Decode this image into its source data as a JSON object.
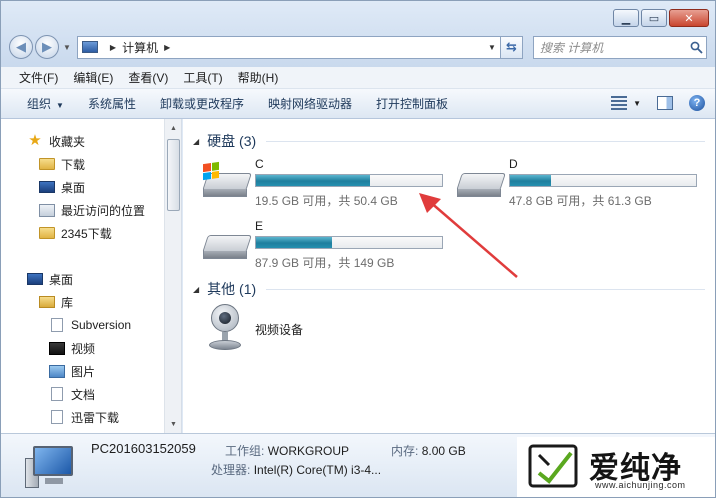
{
  "address": {
    "segments": [
      "计算机"
    ]
  },
  "search": {
    "placeholder": "搜索 计算机"
  },
  "menu": [
    "文件(F)",
    "编辑(E)",
    "查看(V)",
    "工具(T)",
    "帮助(H)"
  ],
  "toolbar": {
    "organize": "组织",
    "items": [
      "系统属性",
      "卸载或更改程序",
      "映射网络驱动器",
      "打开控制面板"
    ]
  },
  "sidebar": {
    "favorites": {
      "label": "收藏夹",
      "items": [
        "下载",
        "桌面",
        "最近访问的位置",
        "2345下载"
      ]
    },
    "desktop": {
      "label": "桌面"
    },
    "library": {
      "label": "库",
      "items": [
        "Subversion",
        "视频",
        "图片",
        "文档",
        "迅雷下载"
      ]
    }
  },
  "groups": {
    "hard_disks": "硬盘 (3)",
    "other": "其他 (1)"
  },
  "drives": [
    {
      "name": "C",
      "info": "19.5 GB 可用，共 50.4 GB",
      "used_fraction": 0.613
    },
    {
      "name": "D",
      "info": "47.8 GB 可用，共 61.3 GB",
      "used_fraction": 0.22
    },
    {
      "name": "E",
      "info": "87.9 GB 可用，共 149 GB",
      "used_fraction": 0.41
    }
  ],
  "other_devices": [
    {
      "name": "视频设备"
    }
  ],
  "details": {
    "pc_name": "PC201603152059",
    "workgroup_label": "工作组:",
    "workgroup": "WORKGROUP",
    "memory_label": "内存:",
    "memory": "8.00 GB",
    "processor_label": "处理器:",
    "processor": "Intel(R) Core(TM) i3-4..."
  },
  "watermark": {
    "brand": "爱纯净",
    "url": "www.aichunjing.com"
  },
  "colors": {
    "usage_bar": "#1f7f9e",
    "annotation_arrow": "#e03c3c"
  }
}
